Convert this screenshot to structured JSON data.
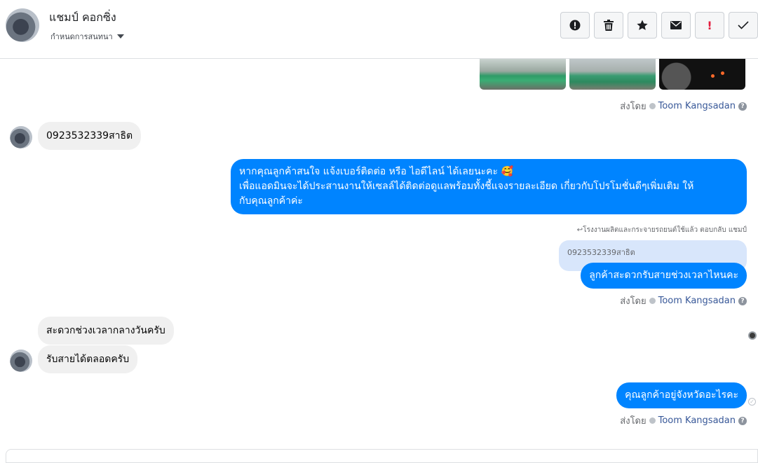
{
  "header": {
    "name": "แชมป์ คอกซิ่ง",
    "subtitle": "กำหนดการสนทนา",
    "icons": [
      "alert-circle-icon",
      "trash-icon",
      "star-icon",
      "envelope-icon",
      "exclamation-icon",
      "check-icon"
    ]
  },
  "sent_by": {
    "prefix": "ส่งโดย",
    "agent": "Toom Kangsadan",
    "help": "?"
  },
  "messages": {
    "m1": "0923532339สาธิต",
    "m2": "หากคุณลูกค้าสนใจ แจ้งเบอร์ติดต่อ หรือ ไอดีไลน์ ได้เลยนะคะ 🥰\nเพื่อแอดมินจะได้ประสานงานให้เซลล์ได้ติดต่อดูแลพร้อมทั้งชี้แจงรายละเอียด เกี่ยวกับโปรโมชั่นดีๆเพิ่มเติม ให้\nกับคุณลูกค้าค่ะ",
    "reply_note": "โรงงานผลิตและกระจายรถยนต์ใช้แล้ว ตอบกลับ แชมป์",
    "quoted": "0923532339สาธิต",
    "m3": "ลูกค้าสะดวกรับสายช่วงเวลาไหนคะ",
    "m4": "สะดวกช่วงเวลากลางวันครับ",
    "m5": "รับสายได้ตลอดครับ",
    "m6": "คุณลูกค้าอยู่จังหวัดอะไรคะ"
  },
  "colors": {
    "outgoing": "#0084ff",
    "incoming": "#f0f0f0",
    "agent_link": "#385898"
  }
}
